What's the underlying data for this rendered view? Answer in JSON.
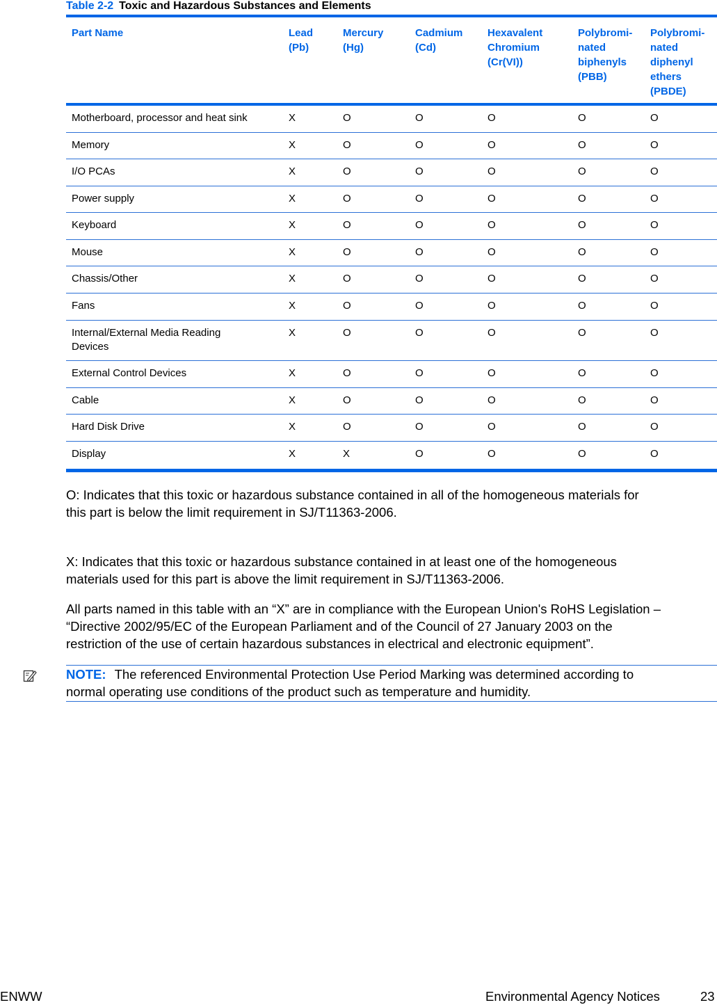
{
  "table": {
    "caption_number": "Table 2-2",
    "caption_title": "Toxic and Hazardous Substances and Elements",
    "headers": [
      [
        "Part Name"
      ],
      [
        "Lead",
        "(Pb)"
      ],
      [
        "Mercury",
        "(Hg)"
      ],
      [
        "Cadmium",
        "(Cd)"
      ],
      [
        "Hexavalent",
        "Chromium",
        "(Cr(VI))"
      ],
      [
        "Polybromi-",
        "nated",
        "biphenyls",
        "(PBB)"
      ],
      [
        "Polybromi-",
        "nated",
        "diphenyl",
        "ethers",
        "(PBDE)"
      ]
    ],
    "rows": [
      {
        "part": "Motherboard, processor and heat sink",
        "values": [
          "X",
          "O",
          "O",
          "O",
          "O",
          "O"
        ]
      },
      {
        "part": "Memory",
        "values": [
          "X",
          "O",
          "O",
          "O",
          "O",
          "O"
        ]
      },
      {
        "part": "I/O PCAs",
        "values": [
          "X",
          "O",
          "O",
          "O",
          "O",
          "O"
        ]
      },
      {
        "part": "Power supply",
        "values": [
          "X",
          "O",
          "O",
          "O",
          "O",
          "O"
        ]
      },
      {
        "part": "Keyboard",
        "values": [
          "X",
          "O",
          "O",
          "O",
          "O",
          "O"
        ]
      },
      {
        "part": "Mouse",
        "values": [
          "X",
          "O",
          "O",
          "O",
          "O",
          "O"
        ]
      },
      {
        "part": "Chassis/Other",
        "values": [
          "X",
          "O",
          "O",
          "O",
          "O",
          "O"
        ]
      },
      {
        "part": "Fans",
        "values": [
          "X",
          "O",
          "O",
          "O",
          "O",
          "O"
        ]
      },
      {
        "part": "Internal/External Media Reading Devices",
        "part_lines": [
          "Internal/External Media Reading",
          "Devices"
        ],
        "values": [
          "X",
          "O",
          "O",
          "O",
          "O",
          "O"
        ]
      },
      {
        "part": "External Control Devices",
        "values": [
          "X",
          "O",
          "O",
          "O",
          "O",
          "O"
        ]
      },
      {
        "part": "Cable",
        "values": [
          "X",
          "O",
          "O",
          "O",
          "O",
          "O"
        ]
      },
      {
        "part": "Hard Disk Drive",
        "values": [
          "X",
          "O",
          "O",
          "O",
          "O",
          "O"
        ]
      },
      {
        "part": "Display",
        "values": [
          "X",
          "X",
          "O",
          "O",
          "O",
          "O"
        ]
      }
    ]
  },
  "paragraphs": [
    [
      "O: Indicates that this toxic or hazardous substance contained in all of the homogeneous materials for",
      "this part is below the limit requirement in SJ/T11363-2006."
    ],
    [
      "X: Indicates that this toxic or hazardous substance contained in at least one of the homogeneous",
      "materials used for this part is above the limit requirement in SJ/T11363-2006."
    ],
    [
      "All parts named in this table with an “X” are in compliance with the European Union's RoHS Legislation –",
      "“Directive 2002/95/EC of the European Parliament and of the Council of 27 January 2003 on the",
      "restriction of the use of certain hazardous substances in electrical and electronic equipment”."
    ]
  ],
  "note": {
    "icon": "note-pencil-icon",
    "label": "NOTE:",
    "lines": [
      "The referenced Environmental Protection Use Period Marking was determined according to",
      "normal operating use conditions of the product such as temperature and humidity."
    ]
  },
  "footer": {
    "left": "ENWW",
    "section": "Environmental Agency Notices",
    "page_number": "23"
  },
  "colors": {
    "accent": "#0066e6"
  }
}
